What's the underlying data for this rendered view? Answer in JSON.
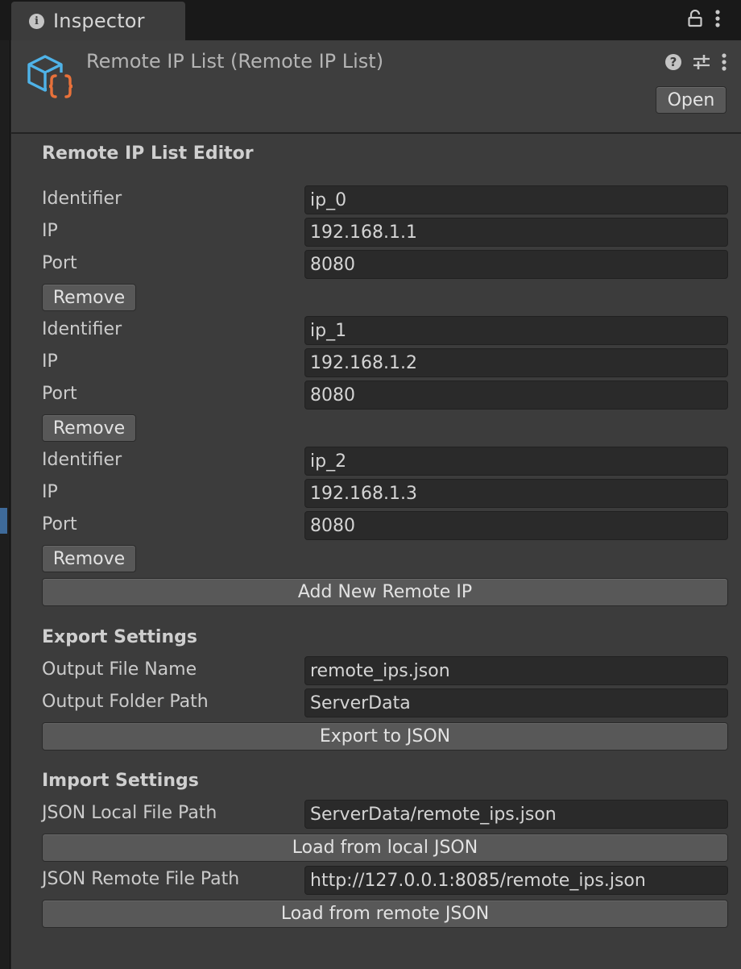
{
  "tab": {
    "title": "Inspector",
    "info_icon": "info-icon",
    "lock_icon": "lock-icon",
    "menu_icon": "kebab-menu-icon"
  },
  "header": {
    "title": "Remote IP List (Remote IP List)",
    "asset_icon": "scriptable-object-icon",
    "open_label": "Open",
    "icons": [
      "help-icon",
      "settings-sliders-icon",
      "kebab-menu-icon"
    ]
  },
  "editor": {
    "title": "Remote IP List Editor",
    "labels": {
      "identifier": "Identifier",
      "ip": "IP",
      "port": "Port",
      "remove": "Remove"
    },
    "entries": [
      {
        "identifier": "ip_0",
        "ip": "192.168.1.1",
        "port": "8080"
      },
      {
        "identifier": "ip_1",
        "ip": "192.168.1.2",
        "port": "8080"
      },
      {
        "identifier": "ip_2",
        "ip": "192.168.1.3",
        "port": "8080"
      }
    ],
    "add_label": "Add New Remote IP"
  },
  "export": {
    "title": "Export Settings",
    "file_name_label": "Output File Name",
    "file_name_value": "remote_ips.json",
    "folder_label": "Output Folder Path",
    "folder_value": "ServerData",
    "export_label": "Export to JSON"
  },
  "import": {
    "title": "Import Settings",
    "local_label": "JSON Local File Path",
    "local_value": "ServerData/remote_ips.json",
    "load_local_label": "Load from local JSON",
    "remote_label": "JSON Remote File Path",
    "remote_value": "http://127.0.0.1:8085/remote_ips.json",
    "load_remote_label": "Load from remote JSON"
  },
  "colors": {
    "panel": "#3c3c3c",
    "field": "#2a2a2a",
    "button": "#585858",
    "icon_blue": "#4fb3e8",
    "icon_orange": "#e8713a"
  }
}
